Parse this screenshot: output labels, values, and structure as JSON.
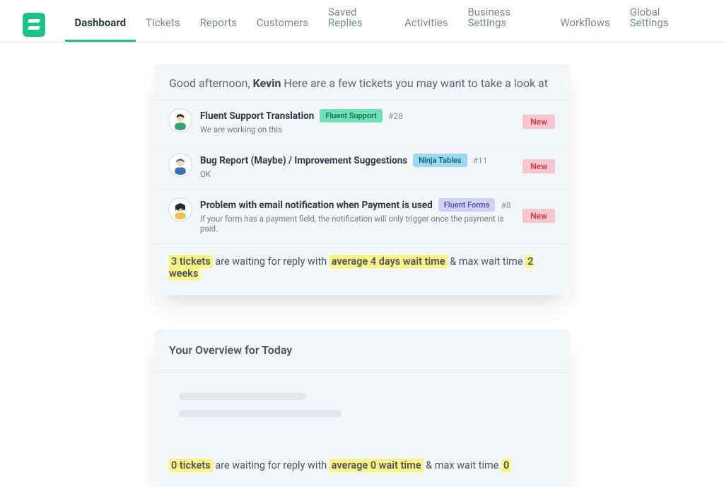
{
  "brand_color": "#20c08b",
  "nav": {
    "left": [
      {
        "label": "Dashboard",
        "active": true
      },
      {
        "label": "Tickets",
        "active": false
      },
      {
        "label": "Reports",
        "active": false
      },
      {
        "label": "Customers",
        "active": false
      }
    ],
    "right": [
      {
        "label": "Saved Replies"
      },
      {
        "label": "Activities"
      },
      {
        "label": "Business Settings"
      },
      {
        "label": "Workflows"
      },
      {
        "label": "Global Settings"
      }
    ]
  },
  "greeting": {
    "prefix": "Good afternoon, ",
    "name": "Kevin",
    "suffix": " Here are a few tickets you may want to take a look at"
  },
  "tickets": [
    {
      "title": "Fluent Support Translation",
      "tag_label": "Fluent Support",
      "tag_style": "green",
      "number": "#28",
      "subtitle": "We are working on this",
      "status": "New"
    },
    {
      "title": "Bug Report (Maybe) / Improvement Suggestions",
      "tag_label": "Ninja Tables",
      "tag_style": "blue",
      "number": "#11",
      "subtitle": "OK",
      "status": "New"
    },
    {
      "title": "Problem with email notification when Payment is used",
      "tag_label": "Fluent Forms",
      "tag_style": "lilac",
      "number": "#8",
      "subtitle": "If your form has a payment field, the notification will only trigger once the payment is paid.",
      "status": "New"
    }
  ],
  "tickets_summary": {
    "count": "3 tickets",
    "mid1": " are waiting for reply with ",
    "avg": "average 4 days wait time",
    "mid2": " & max wait time ",
    "max": "2 weeks"
  },
  "overview": {
    "title": "Your Overview for Today",
    "summary": {
      "count": "0 tickets",
      "mid1": " are waiting for reply with ",
      "avg": "average  0  wait time",
      "mid2": " & max wait time  ",
      "max": "0"
    }
  }
}
